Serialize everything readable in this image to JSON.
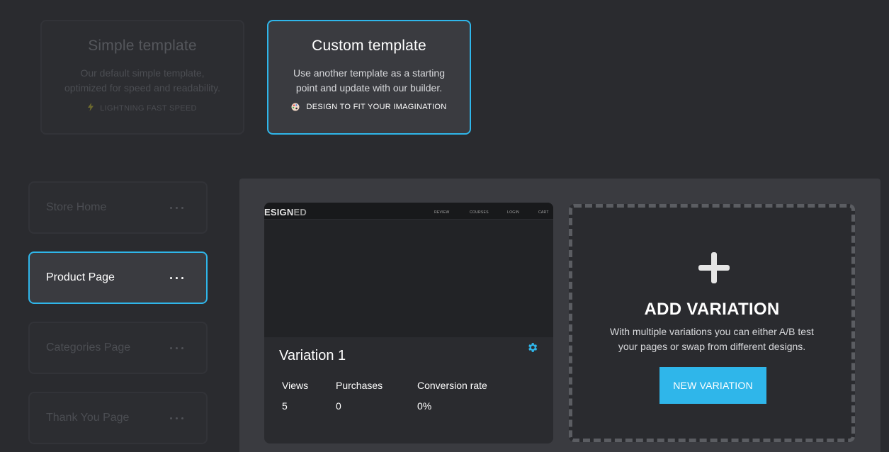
{
  "templates": {
    "simple": {
      "title": "Simple template",
      "desc_line1": "Our default simple template,",
      "desc_line2": "optimized for speed and readability.",
      "tag_icon": "lightning-icon",
      "tag": "LIGHTNING FAST SPEED"
    },
    "custom": {
      "title": "Custom template",
      "desc_line1": "Use another template as a starting",
      "desc_line2": "point and update with our builder.",
      "tag_icon": "palette-icon",
      "tag": "DESIGN TO FIT YOUR IMAGINATION",
      "selected": true
    }
  },
  "pages": [
    {
      "label": "Store Home",
      "active": false
    },
    {
      "label": "Product Page",
      "active": true
    },
    {
      "label": "Categories Page",
      "active": false
    },
    {
      "label": "Thank You Page",
      "active": false
    }
  ],
  "variation": {
    "preview": {
      "logo_main": "ESIGN",
      "logo_suffix": "ED",
      "nav": [
        "REVIEW",
        "COURSES",
        "LOGIN",
        "CART"
      ]
    },
    "title": "Variation 1",
    "stats": {
      "views_label": "Views",
      "views": "5",
      "purchases_label": "Purchases",
      "purchases": "0",
      "conversion_label": "Conversion rate",
      "conversion": "0%"
    }
  },
  "add_variation": {
    "title": "ADD VARIATION",
    "desc_line1": "With multiple variations you can either A/B test",
    "desc_line2": "your pages or swap from different designs.",
    "button": "NEW VARIATION"
  },
  "colors": {
    "accent": "#2fb6ea",
    "background": "#2a2b2f",
    "panel": "#3a3b40"
  }
}
